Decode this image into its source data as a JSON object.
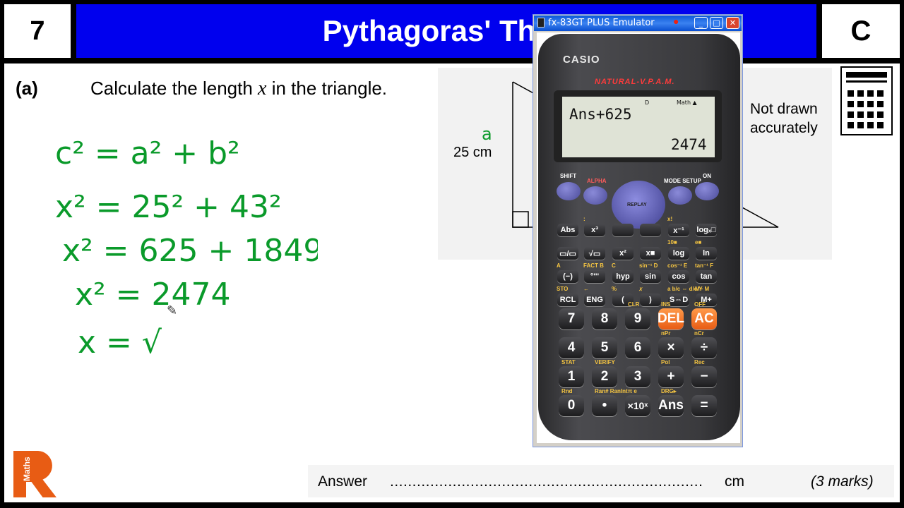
{
  "header": {
    "question_number": "7",
    "title": "Pythagoras' Theo",
    "grade": "C"
  },
  "question": {
    "part": "(a)",
    "text_before": "Calculate the length ",
    "variable": "x",
    "text_after": " in the triangle.",
    "not_drawn": [
      "Not drawn",
      "accurately"
    ],
    "side_label": "25 cm",
    "side_annotation": "a"
  },
  "working": {
    "line1": "c² = a² + b²",
    "line2": "x² = 25² + 43²",
    "line3": "x² = 625 + 1849",
    "line4": "x² = 2474",
    "line5": "x = √"
  },
  "answer": {
    "label": "Answer",
    "dots": "......................................................................",
    "unit": "cm",
    "marks": "(3 marks)"
  },
  "logo": {
    "letter": "R",
    "text": "Maths",
    "color": "#e85c14"
  },
  "emulator": {
    "window_title": "fx-83GT PLUS Emulator",
    "brand": "CASIO",
    "subtitle": "NATURAL-V.P.A.M.",
    "display": {
      "input": "Ans+625",
      "result": "2474",
      "mode": "Math ▲",
      "indicator": "D"
    },
    "top_labels": {
      "shift": "SHIFT",
      "alpha": "ALPHA",
      "mode": "MODE SETUP",
      "on": "ON",
      "replay": "REPLAY"
    },
    "func_rows": [
      [
        "Abs",
        "x³",
        "",
        "",
        "x⁻¹",
        "logₓ□"
      ],
      [
        "▭/▭",
        "√▭",
        "x²",
        "x■",
        "log",
        "ln"
      ],
      [
        "(−)",
        "°'''",
        "hyp",
        "sin",
        "cos",
        "tan"
      ],
      [
        "RCL",
        "ENG",
        "(",
        ")",
        "S⇔D",
        "M+"
      ]
    ],
    "func_secondary": [
      [
        "",
        ":",
        "",
        "",
        "x!",
        ""
      ],
      [
        "",
        "",
        "",
        "",
        "10■",
        "e■"
      ],
      [
        "A",
        "FACT B",
        "C",
        "sin⁻¹ D",
        "cos⁻¹ E",
        "tan⁻¹ F"
      ],
      [
        "STO",
        "←",
        "%",
        "𝑥",
        "a b/c ⇔ d/c Y",
        "M− M"
      ]
    ],
    "num_rows": [
      [
        "7",
        "8",
        "9",
        "DEL",
        "AC"
      ],
      [
        "4",
        "5",
        "6",
        "×",
        "÷"
      ],
      [
        "1",
        "2",
        "3",
        "+",
        "−"
      ],
      [
        "0",
        "•",
        "×10ˣ",
        "Ans",
        "="
      ]
    ],
    "num_secondary": [
      [
        "",
        "",
        "CLR",
        "INS",
        "OFF"
      ],
      [
        "",
        "",
        "",
        "nPr",
        "nCr"
      ],
      [
        "STAT",
        "VERIFY",
        "",
        "Pol",
        "Rec"
      ],
      [
        "Rnd",
        "Ran# RanInt",
        "π e",
        "DRG▸",
        ""
      ]
    ]
  }
}
